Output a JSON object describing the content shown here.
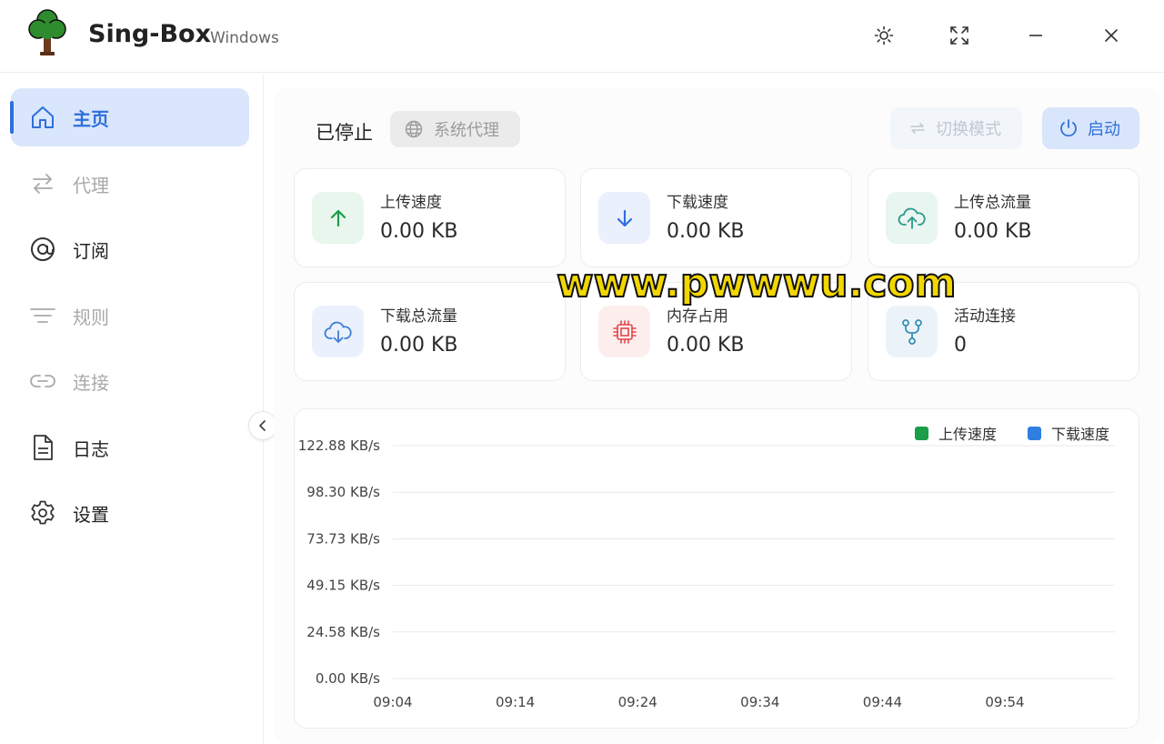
{
  "app": {
    "title": "Sing-Box",
    "platform": "Windows",
    "window_controls": [
      "sun-icon",
      "fullscreen-icon",
      "minimize-icon",
      "close-icon"
    ]
  },
  "sidebar": {
    "items": [
      {
        "label": "主页",
        "icon": "home-icon",
        "state": "active"
      },
      {
        "label": "代理",
        "icon": "swap-icon",
        "state": "muted"
      },
      {
        "label": "订阅",
        "icon": "at-icon",
        "state": "normal"
      },
      {
        "label": "规则",
        "icon": "filter-lines-icon",
        "state": "muted"
      },
      {
        "label": "连接",
        "icon": "link-icon",
        "state": "muted"
      },
      {
        "label": "日志",
        "icon": "document-icon",
        "state": "normal"
      },
      {
        "label": "设置",
        "icon": "gear-icon",
        "state": "normal"
      }
    ]
  },
  "toolbar": {
    "status": "已停止",
    "system_proxy_label": "系统代理",
    "switch_mode_label": "切换模式",
    "start_label": "启动"
  },
  "stats": [
    {
      "label": "上传速度",
      "value": "0.00 KB",
      "icon": "arrow-up-icon",
      "color": "#1a9e4a",
      "bg": "#e9f6ee"
    },
    {
      "label": "下载速度",
      "value": "0.00 KB",
      "icon": "arrow-down-icon",
      "color": "#2f6fdc",
      "bg": "#eaf1fd"
    },
    {
      "label": "上传总流量",
      "value": "0.00 KB",
      "icon": "cloud-upload-icon",
      "color": "#2a9a8a",
      "bg": "#e9f5f1"
    },
    {
      "label": "下载总流量",
      "value": "0.00 KB",
      "icon": "cloud-download-icon",
      "color": "#3f7fd6",
      "bg": "#eaf1fc"
    },
    {
      "label": "内存占用",
      "value": "0.00 KB",
      "icon": "chip-icon",
      "color": "#e0474c",
      "bg": "#fdeeee"
    },
    {
      "label": "活动连接",
      "value": "0",
      "icon": "branch-icon",
      "color": "#3a8fb7",
      "bg": "#ecf3f8"
    }
  ],
  "watermark": "www.pwwwu.com",
  "chart_data": {
    "type": "line",
    "x": [
      "09:04",
      "09:14",
      "09:24",
      "09:34",
      "09:44",
      "09:54"
    ],
    "yticks": [
      "0.00 KB/s",
      "24.58 KB/s",
      "49.15 KB/s",
      "73.73 KB/s",
      "98.30 KB/s",
      "122.88 KB/s"
    ],
    "ylim": [
      0,
      122.88
    ],
    "legend_position": "top-right",
    "grid": true,
    "series": [
      {
        "name": "上传速度",
        "color": "#1a9e4a",
        "values": [
          0,
          0,
          0,
          0,
          0,
          0
        ]
      },
      {
        "name": "下载速度",
        "color": "#2f7fe0",
        "values": [
          0,
          0,
          0,
          0,
          0,
          0
        ]
      }
    ]
  }
}
